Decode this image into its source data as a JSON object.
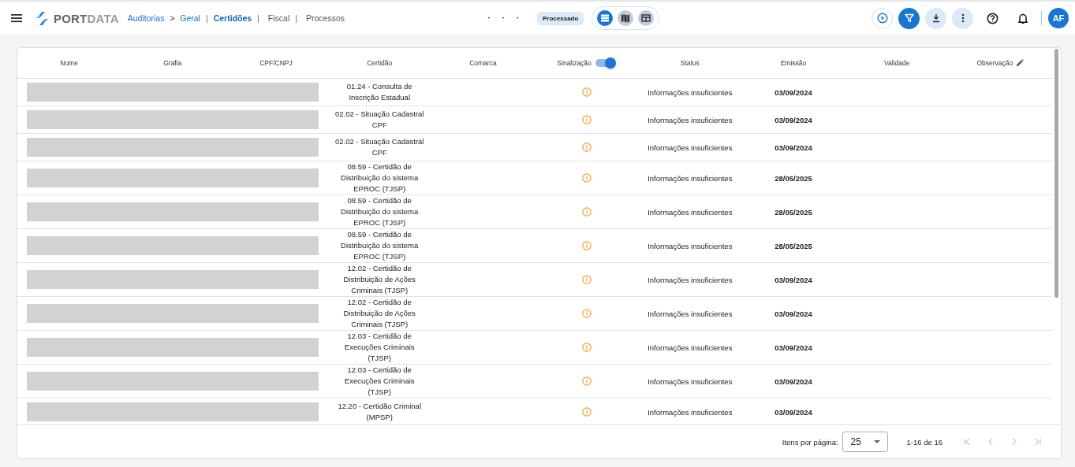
{
  "topbar": {
    "brand": {
      "strong": "PORT",
      "light": "DATA"
    },
    "breadcrumbs": [
      {
        "label": "Auditorias",
        "kind": "link",
        "selected": false
      },
      {
        "label": ">",
        "kind": "sep"
      },
      {
        "label": "Geral",
        "kind": "link",
        "selected": false
      },
      {
        "label": "|",
        "kind": "bar"
      },
      {
        "label": "Certidões",
        "kind": "link",
        "selected": true
      },
      {
        "label": "|",
        "kind": "bar"
      },
      {
        "label": "Fiscal",
        "kind": "plain",
        "selected": false
      },
      {
        "label": "|",
        "kind": "bar"
      },
      {
        "label": "Processos",
        "kind": "plain",
        "selected": false
      }
    ],
    "status_chip": "Processado",
    "view_buttons": [
      {
        "kind": "list",
        "selected": true
      },
      {
        "kind": "map",
        "selected": false
      },
      {
        "kind": "grid",
        "selected": false
      }
    ],
    "actions": [
      {
        "kind": "play"
      },
      {
        "kind": "filter"
      },
      {
        "kind": "download"
      },
      {
        "kind": "more"
      },
      {
        "kind": "help"
      },
      {
        "kind": "bell"
      }
    ],
    "avatar": "AF"
  },
  "table": {
    "columns": [
      {
        "label": "Nome"
      },
      {
        "label": "Grafia"
      },
      {
        "label": "CPF/CNPJ"
      },
      {
        "label": "Certidão"
      },
      {
        "label": "Comarca"
      },
      {
        "label": "Sinalização",
        "toggle_on": true
      },
      {
        "label": "Status"
      },
      {
        "label": "Emissão"
      },
      {
        "label": "Validade"
      },
      {
        "label": "Observação",
        "editable": true
      }
    ],
    "rows": [
      {
        "certidao": "01.24 - Consulta de\nInscrição Estadual",
        "status": "Informações insuficientes",
        "emissao": "03/09/2024"
      },
      {
        "certidao": "02.02 - Situação Cadastral\nCPF",
        "status": "Informações insuficientes",
        "emissao": "03/09/2024"
      },
      {
        "certidao": "02.02 - Situação Cadastral\nCPF",
        "status": "Informações insuficientes",
        "emissao": "03/09/2024"
      },
      {
        "certidao": "08.59 - Certidão de\nDistribuição do sistema\nEPROC (TJSP)",
        "status": "Informações insuficientes",
        "emissao": "28/05/2025"
      },
      {
        "certidao": "08.59 - Certidão de\nDistribuição do sistema\nEPROC (TJSP)",
        "status": "Informações insuficientes",
        "emissao": "28/05/2025"
      },
      {
        "certidao": "08.59 - Certidão de\nDistribuição do sistema\nEPROC (TJSP)",
        "status": "Informações insuficientes",
        "emissao": "28/05/2025"
      },
      {
        "certidao": "12.02 - Certidão de\nDistribuição de Ações\nCriminais (TJSP)",
        "status": "Informações insuficientes",
        "emissao": "03/09/2024"
      },
      {
        "certidao": "12.02 - Certidão de\nDistribuição de Ações\nCriminais (TJSP)",
        "status": "Informações insuficientes",
        "emissao": "03/09/2024"
      },
      {
        "certidao": "12.03 - Certidão de\nExecuções Criminais\n(TJSP)",
        "status": "Informações insuficientes",
        "emissao": "03/09/2024"
      },
      {
        "certidao": "12.03 - Certidão de\nExecuções Criminais\n(TJSP)",
        "status": "Informações insuficientes",
        "emissao": "03/09/2024"
      },
      {
        "certidao": "12.20 - Certidão Criminal\n(MPSP)",
        "status": "Informações insuficientes",
        "emissao": "03/09/2024"
      }
    ]
  },
  "pager": {
    "label": "Itens por página:",
    "page_size": "25",
    "range": "1-16 de 16",
    "nav": [
      {
        "kind": "first",
        "disabled": true
      },
      {
        "kind": "prev",
        "disabled": true
      },
      {
        "kind": "next",
        "disabled": true
      },
      {
        "kind": "last",
        "disabled": true
      }
    ]
  }
}
